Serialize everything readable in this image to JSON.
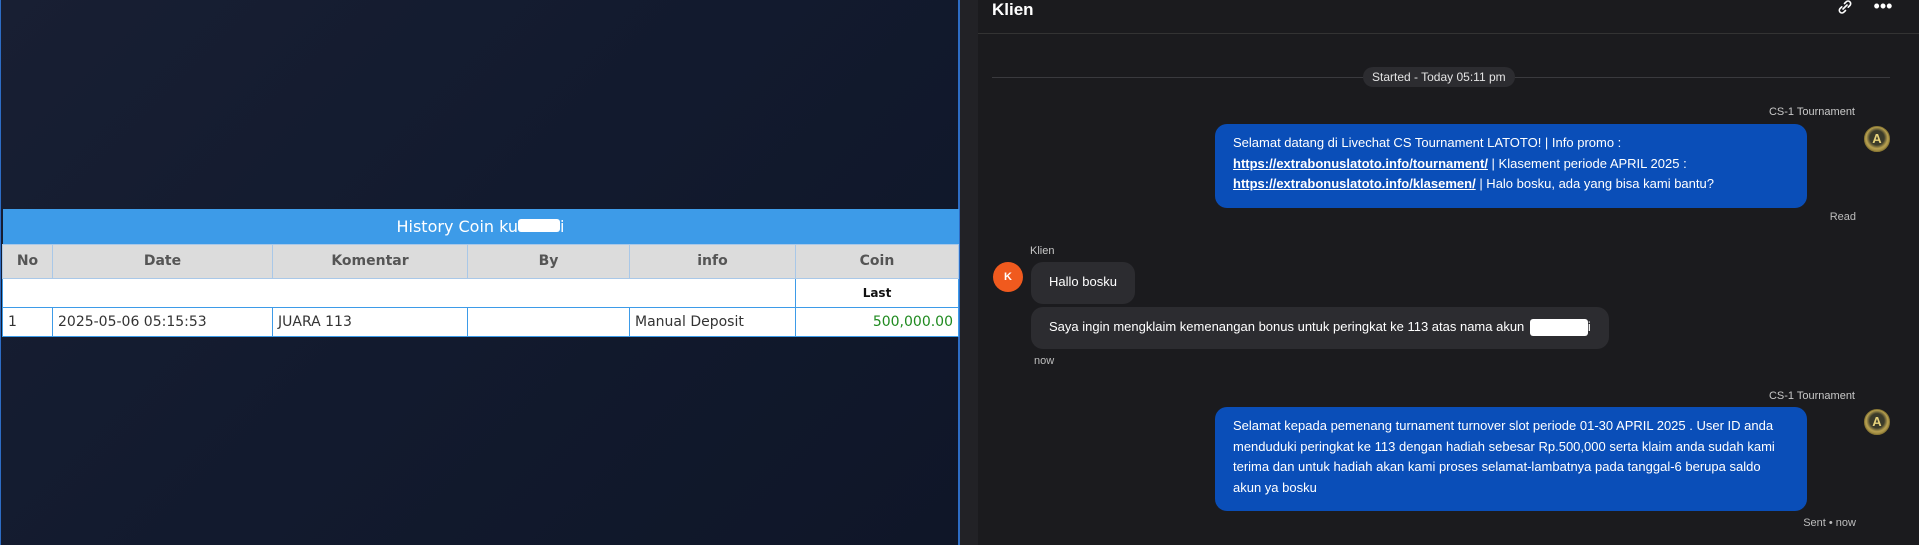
{
  "coin_history": {
    "title_prefix": "History Coin ku",
    "title_suffix": "i",
    "columns": [
      "No",
      "Date",
      "Komentar",
      "By",
      "info",
      "Coin"
    ],
    "sub_header_label": "Last",
    "rows": [
      {
        "no": "1",
        "date": "2025-05-06 05:15:53",
        "komentar": "JUARA 113",
        "by": "",
        "info": "Manual Deposit",
        "coin": "500,000.00"
      }
    ]
  },
  "chat": {
    "title": "Klien",
    "started_label": "Started - Today 05:11 pm",
    "messages": {
      "agent1": {
        "sender": "CS-1 Tournament",
        "text_1": "Selamat datang di Livechat CS Tournament LATOTO! | Info promo :",
        "link_1": "https://extrabonuslatoto.info/tournament/",
        "text_2": " | Klasement periode APRIL 2025 :",
        "link_2": "https://extrabonuslatoto.info/klasemen/",
        "text_3": " | Halo bosku, ada yang bisa kami bantu?",
        "status": "Read"
      },
      "client": {
        "sender": "Klien",
        "avatar_letter": "K",
        "message_1": "Hallo bosku",
        "message_2_prefix": "Saya ingin mengklaim kemenangan bonus untuk peringkat ke 113 atas nama akun",
        "message_2_suffix": "i",
        "time": "now"
      },
      "agent2": {
        "sender": "CS-1 Tournament",
        "text": "Selamat kepada pemenang turnament turnover slot periode 01-30 APRIL 2025 . User ID anda menduduki peringkat ke 113 dengan hadiah sebesar Rp.500,000 serta klaim anda sudah kami terima dan untuk hadiah akan kami proses selamat-lambatnya pada tanggal-6 berupa saldo akun ya bosku",
        "status": "Sent • now"
      }
    }
  },
  "icons": {
    "link": "link-icon",
    "more": "more-options-icon",
    "agent_avatar": "agent-avatar-logo"
  },
  "colors": {
    "table_header_blue": "#3d9be8",
    "agent_bubble": "#0a4eb8",
    "client_avatar": "#f05a1e",
    "coin_green": "#1f8a1f"
  }
}
